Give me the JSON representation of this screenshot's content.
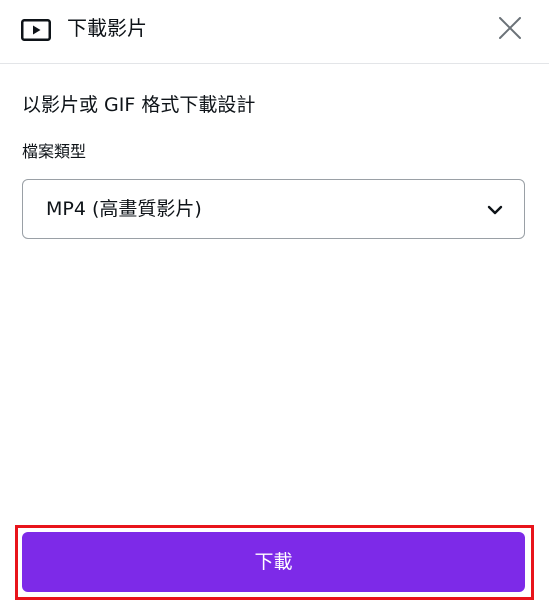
{
  "header": {
    "icon": "video-play-icon",
    "title": "下載影片",
    "close_icon": "close-icon"
  },
  "main": {
    "subtitle": "以影片或 GIF 格式下載設計",
    "file_type_label": "檔案類型",
    "file_type_select": {
      "selected": "MP4 (高畫質影片)",
      "icon": "chevron-down-icon"
    }
  },
  "footer": {
    "download_label": "下載"
  },
  "colors": {
    "accent": "#7d2ae8",
    "highlight": "#e8141b",
    "text": "#0e1318"
  }
}
